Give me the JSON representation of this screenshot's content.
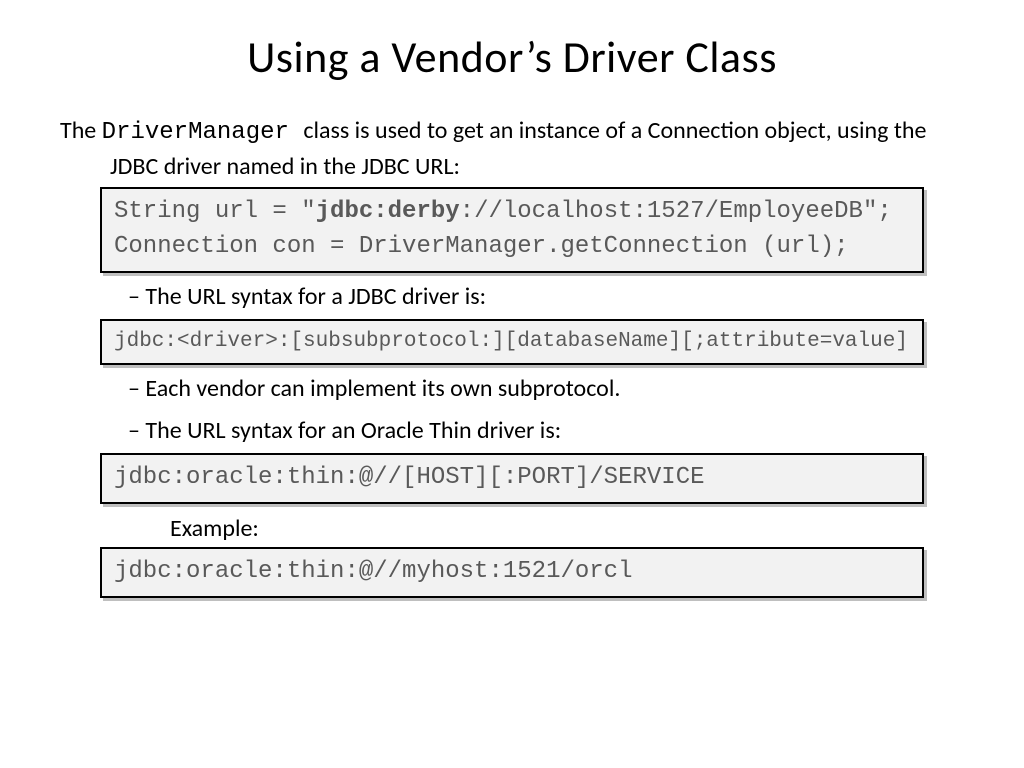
{
  "title": "Using a Vendor’s Driver Class",
  "intro_part1": "The ",
  "intro_code": "DriverManager ",
  "intro_part2": "class is used to get an instance of a Connection object, using the JDBC driver named in the JDBC URL:",
  "codebox1_line1_pre": "String url = \"",
  "codebox1_line1_bold": "jdbc:derby",
  "codebox1_line1_post": "://localhost:1527/EmployeeDB\";",
  "codebox1_line2": "Connection con = DriverManager.getConnection (url);",
  "bullet1": "The URL syntax for a JDBC driver is:",
  "codebox2": "jdbc:<driver>:[subsubprotocol:][databaseName][;attribute=value]",
  "bullet2": "Each vendor can implement its own subprotocol.",
  "bullet3": "The URL syntax for an Oracle Thin driver is:",
  "codebox3": "jdbc:oracle:thin:@//[HOST][:PORT]/SERVICE",
  "example_label": "Example:",
  "codebox4": "jdbc:oracle:thin:@//myhost:1521/orcl"
}
